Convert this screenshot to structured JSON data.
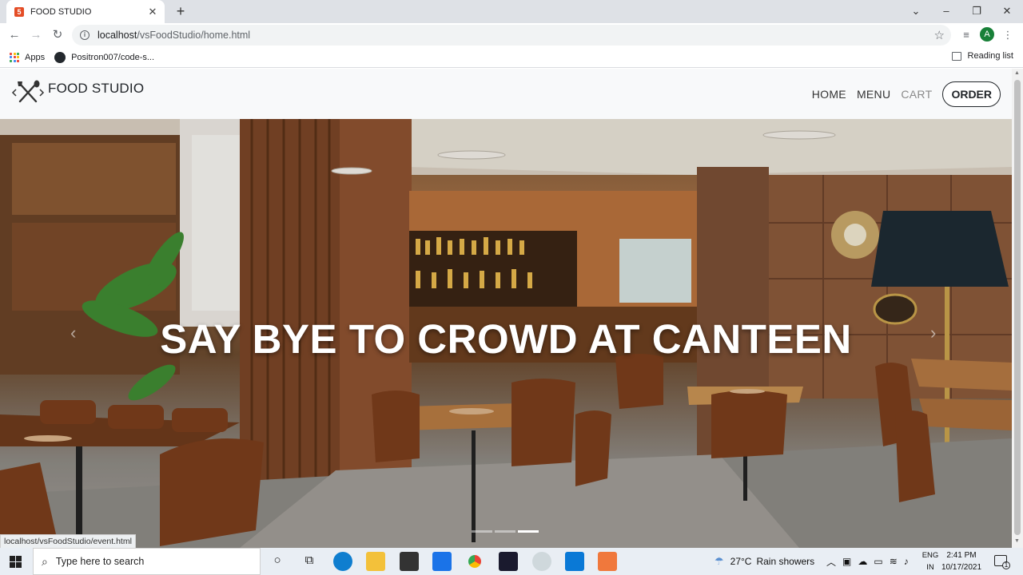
{
  "browser": {
    "tab_title": "FOOD STUDIO",
    "tab_favicon": "html5-icon",
    "url_host": "localhost",
    "url_path": "/vsFoodStudio/home.html",
    "profile_initial": "A",
    "bookmarks": [
      {
        "label": "Apps",
        "icon": "apps-grid-icon"
      },
      {
        "label": "Positron007/code-s...",
        "icon": "github-icon"
      }
    ],
    "reading_list": "Reading list",
    "status_url": "localhost/vsFoodStudio/event.html"
  },
  "site": {
    "brand": "FOOD STUDIO",
    "nav": {
      "home": "HOME",
      "menu": "MENU",
      "cart": "CART",
      "order": "ORDER"
    },
    "hero": {
      "caption": "SAY BYE TO CROWD AT CANTEEN",
      "slide_count": 3,
      "active_slide": 3
    }
  },
  "taskbar": {
    "search_placeholder": "Type here to search",
    "weather_temp": "27°C",
    "weather_desc": "Rain showers",
    "lang_line1": "ENG",
    "lang_line2": "IN",
    "time": "2:41 PM",
    "date": "10/17/2021",
    "notification_count": "1"
  },
  "colors": {
    "accent_green": "#188038",
    "nav_bg": "#f8f9fa",
    "taskbar_bg": "#e9eef4"
  }
}
